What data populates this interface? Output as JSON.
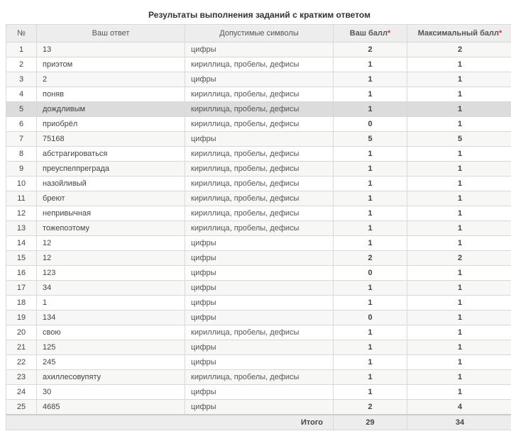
{
  "title": "Результаты выполнения заданий с кратким ответом",
  "headers": {
    "num": "№",
    "answer": "Ваш ответ",
    "symbols": "Допустимые символы",
    "score": "Ваш балл",
    "max": "Максимальный балл",
    "star": "*"
  },
  "rows": [
    {
      "n": "1",
      "answer": "13",
      "symbols": "цифры",
      "score": "2",
      "max": "2",
      "hl": false
    },
    {
      "n": "2",
      "answer": "приэтом",
      "symbols": "кириллица, пробелы, дефисы",
      "score": "1",
      "max": "1",
      "hl": false
    },
    {
      "n": "3",
      "answer": "2",
      "symbols": "цифры",
      "score": "1",
      "max": "1",
      "hl": false
    },
    {
      "n": "4",
      "answer": "поняв",
      "symbols": "кириллица, пробелы, дефисы",
      "score": "1",
      "max": "1",
      "hl": false
    },
    {
      "n": "5",
      "answer": "дождливым",
      "symbols": "кириллица, пробелы, дефисы",
      "score": "1",
      "max": "1",
      "hl": true
    },
    {
      "n": "6",
      "answer": "приобрёл",
      "symbols": "кириллица, пробелы, дефисы",
      "score": "0",
      "max": "1",
      "hl": false
    },
    {
      "n": "7",
      "answer": "75168",
      "symbols": "цифры",
      "score": "5",
      "max": "5",
      "hl": false
    },
    {
      "n": "8",
      "answer": "абстрагироваться",
      "symbols": "кириллица, пробелы, дефисы",
      "score": "1",
      "max": "1",
      "hl": false
    },
    {
      "n": "9",
      "answer": "преуспелпреграда",
      "symbols": "кириллица, пробелы, дефисы",
      "score": "1",
      "max": "1",
      "hl": false
    },
    {
      "n": "10",
      "answer": "назойливый",
      "symbols": "кириллица, пробелы, дефисы",
      "score": "1",
      "max": "1",
      "hl": false
    },
    {
      "n": "11",
      "answer": "бреют",
      "symbols": "кириллица, пробелы, дефисы",
      "score": "1",
      "max": "1",
      "hl": false
    },
    {
      "n": "12",
      "answer": "непривычная",
      "symbols": "кириллица, пробелы, дефисы",
      "score": "1",
      "max": "1",
      "hl": false
    },
    {
      "n": "13",
      "answer": "тожепоэтому",
      "symbols": "кириллица, пробелы, дефисы",
      "score": "1",
      "max": "1",
      "hl": false
    },
    {
      "n": "14",
      "answer": "12",
      "symbols": "цифры",
      "score": "1",
      "max": "1",
      "hl": false
    },
    {
      "n": "15",
      "answer": "12",
      "symbols": "цифры",
      "score": "2",
      "max": "2",
      "hl": false
    },
    {
      "n": "16",
      "answer": "123",
      "symbols": "цифры",
      "score": "0",
      "max": "1",
      "hl": false
    },
    {
      "n": "17",
      "answer": "34",
      "symbols": "цифры",
      "score": "1",
      "max": "1",
      "hl": false
    },
    {
      "n": "18",
      "answer": "1",
      "symbols": "цифры",
      "score": "1",
      "max": "1",
      "hl": false
    },
    {
      "n": "19",
      "answer": "134",
      "symbols": "цифры",
      "score": "0",
      "max": "1",
      "hl": false
    },
    {
      "n": "20",
      "answer": "свою",
      "symbols": "кириллица, пробелы, дефисы",
      "score": "1",
      "max": "1",
      "hl": false
    },
    {
      "n": "21",
      "answer": "125",
      "symbols": "цифры",
      "score": "1",
      "max": "1",
      "hl": false
    },
    {
      "n": "22",
      "answer": "245",
      "symbols": "цифры",
      "score": "1",
      "max": "1",
      "hl": false
    },
    {
      "n": "23",
      "answer": "ахиллесовупяту",
      "symbols": "кириллица, пробелы, дефисы",
      "score": "1",
      "max": "1",
      "hl": false
    },
    {
      "n": "24",
      "answer": "30",
      "symbols": "цифры",
      "score": "1",
      "max": "1",
      "hl": false
    },
    {
      "n": "25",
      "answer": "4685",
      "symbols": "цифры",
      "score": "2",
      "max": "4",
      "hl": false
    }
  ],
  "footer": {
    "label": "Итого",
    "score": "29",
    "max": "34"
  }
}
